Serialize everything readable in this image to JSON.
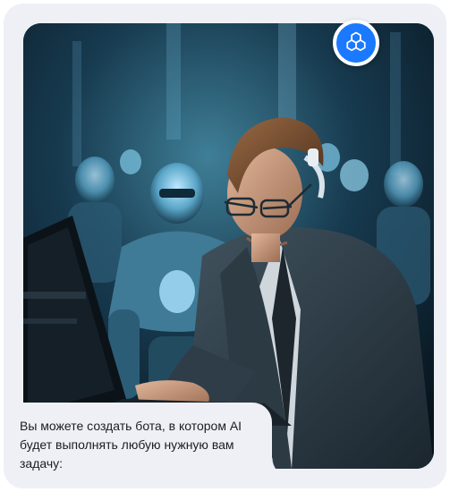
{
  "card": {
    "caption": "Вы можете создать бота, в котором AI будет выполнять любую нужную вам задачу:"
  },
  "badge": {
    "icon": "openai-logo-icon",
    "color": "#1a79ff"
  },
  "image": {
    "subject": "hero-illustration"
  }
}
